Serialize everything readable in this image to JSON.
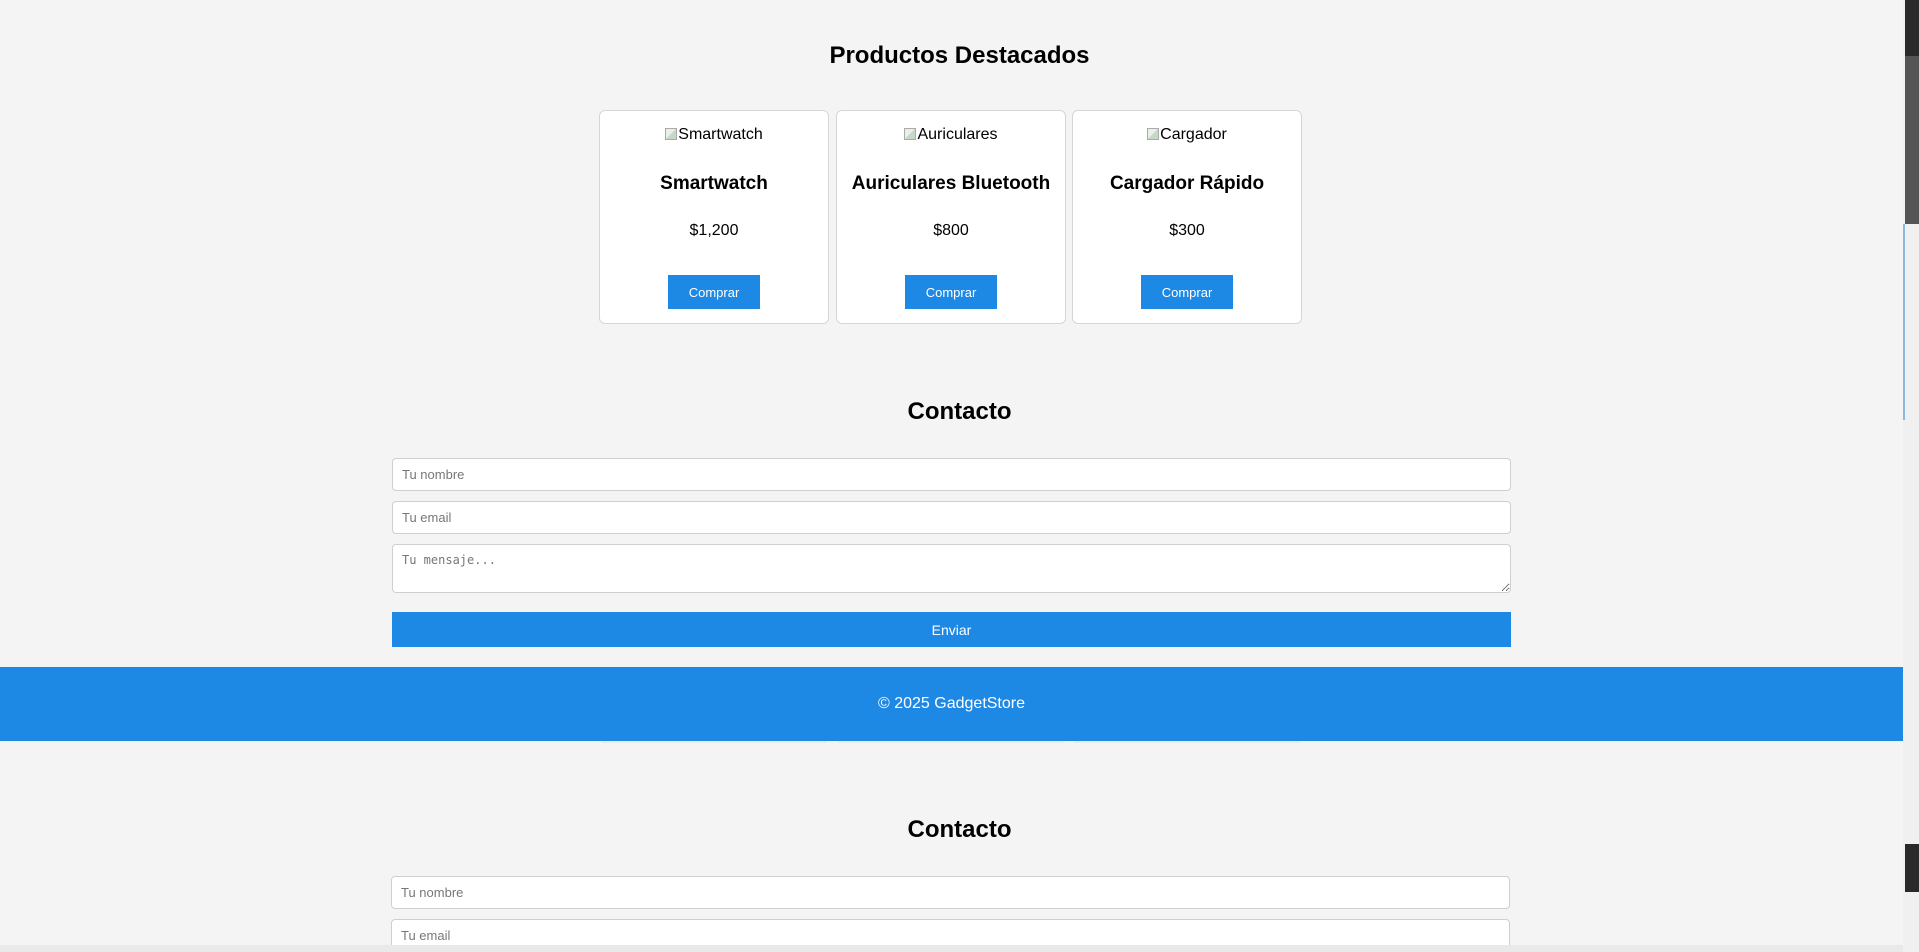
{
  "products": {
    "title": "Productos Destacados",
    "items": [
      {
        "img_alt": "Smartwatch",
        "name": "Smartwatch",
        "price": "$1,200",
        "button": "Comprar"
      },
      {
        "img_alt": "Auriculares",
        "name": "Auriculares Bluetooth",
        "price": "$800",
        "button": "Comprar"
      },
      {
        "img_alt": "Cargador",
        "name": "Cargador Rápido",
        "price": "$300",
        "button": "Comprar"
      }
    ]
  },
  "contact": {
    "title": "Contacto",
    "name_placeholder": "Tu nombre",
    "email_placeholder": "Tu email",
    "message_placeholder": "Tu mensaje...",
    "submit": "Enviar"
  },
  "footer": {
    "text": "© 2025 GadgetStore"
  },
  "colors": {
    "accent": "#1e88e5",
    "background": "#f4f4f4"
  }
}
